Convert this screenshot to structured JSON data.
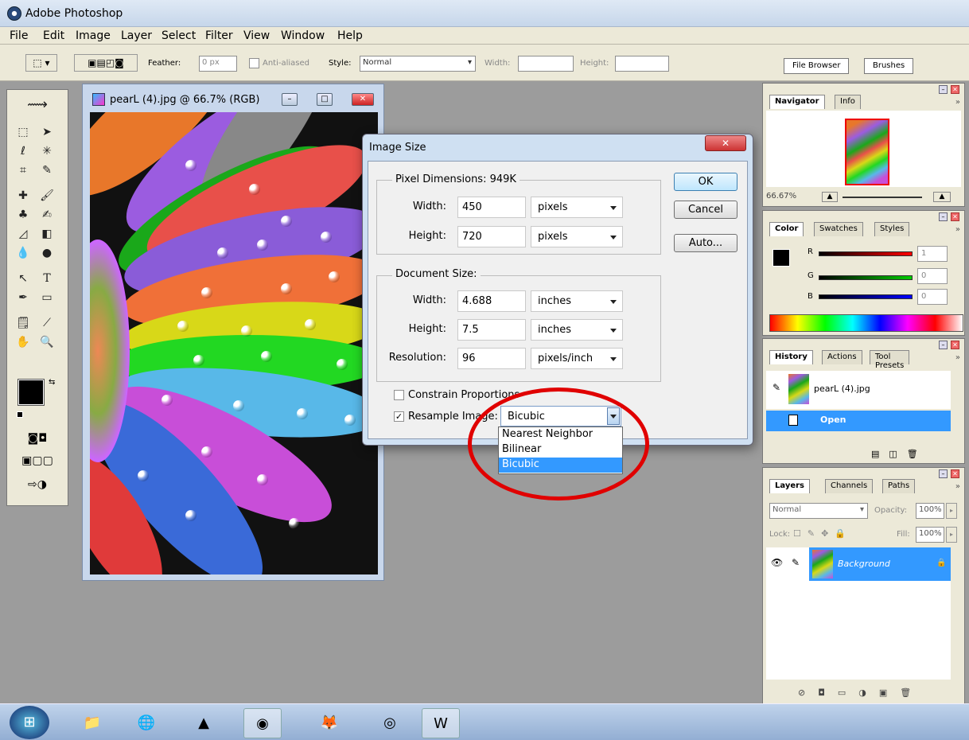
{
  "app": {
    "title": "Adobe Photoshop"
  },
  "menu": [
    "File",
    "Edit",
    "Image",
    "Layer",
    "Select",
    "Filter",
    "View",
    "Window",
    "Help"
  ],
  "options": {
    "feather_label": "Feather:",
    "feather_value": "0 px",
    "antialiased_label": "Anti-aliased",
    "style_label": "Style:",
    "style_value": "Normal",
    "width_label": "Width:",
    "height_label": "Height:",
    "file_browser": "File Browser",
    "brushes": "Brushes"
  },
  "document": {
    "title": "pearL (4).jpg @ 66.7% (RGB)"
  },
  "dialog": {
    "title": "Image Size",
    "pixel_dimensions_label": "Pixel Dimensions: 949K",
    "px_width_label": "Width:",
    "px_width_value": "450",
    "px_width_unit": "pixels",
    "px_height_label": "Height:",
    "px_height_value": "720",
    "px_height_unit": "pixels",
    "document_size_label": "Document Size:",
    "doc_width_label": "Width:",
    "doc_width_value": "4.688",
    "doc_width_unit": "inches",
    "doc_height_label": "Height:",
    "doc_height_value": "7.5",
    "doc_height_unit": "inches",
    "resolution_label": "Resolution:",
    "resolution_value": "96",
    "resolution_unit": "pixels/inch",
    "constrain_label": "Constrain Proportions",
    "resample_label": "Resample Image:",
    "resample_value": "Bicubic",
    "ok": "OK",
    "cancel": "Cancel",
    "auto": "Auto...",
    "resample_options": [
      "Nearest Neighbor",
      "Bilinear",
      "Bicubic"
    ],
    "resample_selected": "Bicubic"
  },
  "navigator": {
    "tabs": [
      "Navigator",
      "Info"
    ],
    "zoom": "66.67%"
  },
  "color": {
    "tabs": [
      "Color",
      "Swatches",
      "Styles"
    ],
    "r": "1",
    "g": "0",
    "b": "0",
    "r_label": "R",
    "g_label": "G",
    "b_label": "B"
  },
  "history": {
    "tabs": [
      "History",
      "Actions",
      "Tool Presets"
    ],
    "snapshot": "pearL (4).jpg",
    "step": "Open"
  },
  "layers": {
    "tabs": [
      "Layers",
      "Channels",
      "Paths"
    ],
    "blend": "Normal",
    "opacity_label": "Opacity:",
    "opacity": "100%",
    "lock_label": "Lock:",
    "fill_label": "Fill:",
    "fill": "100%",
    "layer_name": "Background"
  },
  "colors": {
    "accent": "#3399ff",
    "foreground": "#000000",
    "background": "#e8231a",
    "highlight": "#e00000"
  }
}
